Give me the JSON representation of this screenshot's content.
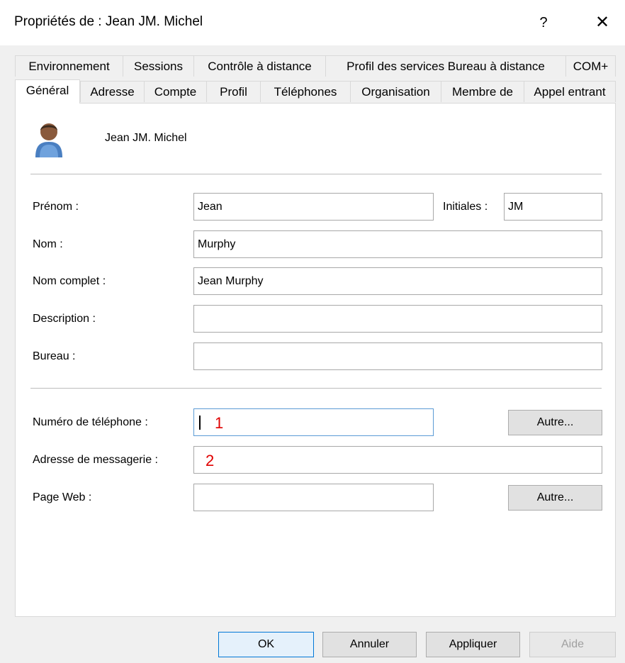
{
  "window": {
    "title": "Propriétés de : Jean JM. Michel",
    "help_glyph": "?",
    "close_glyph": "✕"
  },
  "tabs_row1": [
    {
      "label": "Environnement"
    },
    {
      "label": "Sessions"
    },
    {
      "label": "Contrôle à distance"
    },
    {
      "label": "Profil des services Bureau à distance"
    },
    {
      "label": "COM+"
    }
  ],
  "tabs_row2": [
    {
      "label": "Général",
      "active": true
    },
    {
      "label": "Adresse"
    },
    {
      "label": "Compte"
    },
    {
      "label": "Profil"
    },
    {
      "label": "Téléphones"
    },
    {
      "label": "Organisation"
    },
    {
      "label": "Membre de"
    },
    {
      "label": "Appel entrant"
    }
  ],
  "user": {
    "display_name": "Jean JM. Michel",
    "avatar_icon": "user-icon"
  },
  "form": {
    "prenom_label": "Prénom :",
    "prenom_value": "Jean",
    "initiales_label": "Initiales :",
    "initiales_value": "JM",
    "nom_label": "Nom :",
    "nom_value": "Murphy",
    "nom_complet_label": "Nom complet :",
    "nom_complet_value": "Jean Murphy",
    "description_label": "Description :",
    "description_value": "",
    "bureau_label": "Bureau :",
    "bureau_value": "",
    "telephone_label": "Numéro de téléphone :",
    "telephone_value": "",
    "telephone_other": "Autre...",
    "email_label": "Adresse de messagerie :",
    "email_value": "",
    "web_label": "Page Web :",
    "web_value": "",
    "web_other": "Autre..."
  },
  "annotations": {
    "one": "1",
    "two": "2",
    "color": "#e00000"
  },
  "footer": {
    "ok": "OK",
    "cancel": "Annuler",
    "apply": "Appliquer",
    "help": "Aide"
  }
}
